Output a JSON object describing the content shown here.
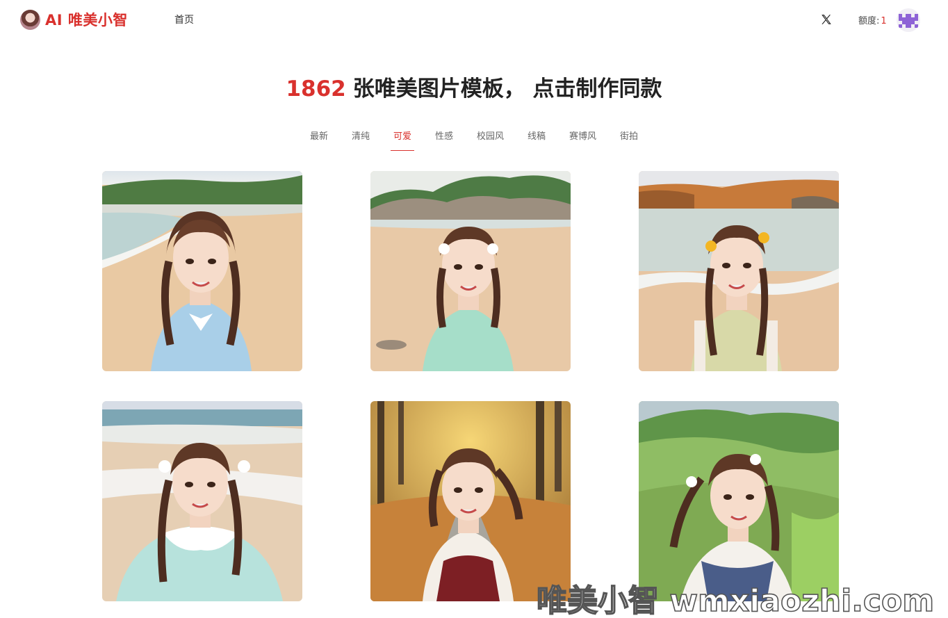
{
  "header": {
    "logo_text": "AI 唯美小智",
    "nav_home": "首页",
    "quota_label": "额度:",
    "quota_value": "1"
  },
  "headline": {
    "count": "1862",
    "text": "张唯美图片模板， 点击制作同款"
  },
  "tabs": [
    {
      "label": "最新",
      "active": false
    },
    {
      "label": "清纯",
      "active": false
    },
    {
      "label": "可爱",
      "active": true
    },
    {
      "label": "性感",
      "active": false
    },
    {
      "label": "校园风",
      "active": false
    },
    {
      "label": "线稿",
      "active": false
    },
    {
      "label": "赛博风",
      "active": false
    },
    {
      "label": "街拍",
      "active": false
    }
  ],
  "gallery": [
    {
      "scene": "beach",
      "outfit_color": "#a9cfe8"
    },
    {
      "scene": "rocky-beach",
      "outfit_color": "#9fdcc4"
    },
    {
      "scene": "autumn-lake",
      "outfit_color": "#d8d9a8"
    },
    {
      "scene": "seaside",
      "outfit_color": "#b7e2dc"
    },
    {
      "scene": "autumn-forest",
      "outfit_color": "#7d1f24"
    },
    {
      "scene": "green-hills",
      "outfit_color": "#f4f1ec"
    }
  ],
  "watermark": "唯美小智 wmxiaozhi.com",
  "colors": {
    "accent": "#d9312d"
  }
}
